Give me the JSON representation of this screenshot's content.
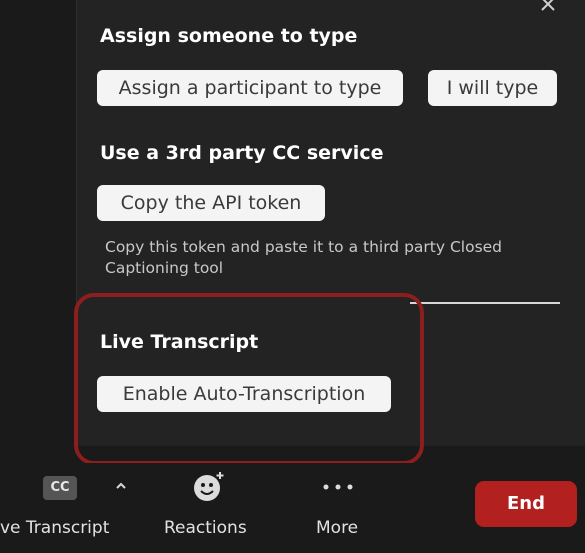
{
  "panel": {
    "sections": {
      "assign": {
        "title": "Assign someone to type",
        "buttons": {
          "assign_participant": "Assign a participant to type",
          "i_will_type": "I will type"
        }
      },
      "third_party": {
        "title": "Use a 3rd party CC service",
        "copy_token": "Copy the API token",
        "helper": "Copy this token and paste it to a third party Closed Captioning tool"
      },
      "live_transcript": {
        "title": "Live Transcript",
        "enable_auto": "Enable Auto-Transcription"
      }
    },
    "icons": {
      "close": "close-icon"
    }
  },
  "toolbar": {
    "cc_badge": "CC",
    "live_transcript_label": "ve Transcript",
    "reactions_label": "Reactions",
    "more_label": "More",
    "end_label": "End",
    "colors": {
      "end": "#b22020"
    },
    "icons": {
      "caret": "chevron-up-icon",
      "reactions": "smiley-plus-icon",
      "more": "more-dots-icon"
    }
  },
  "annotation": {
    "highlight_color": "#8d1e1e"
  }
}
